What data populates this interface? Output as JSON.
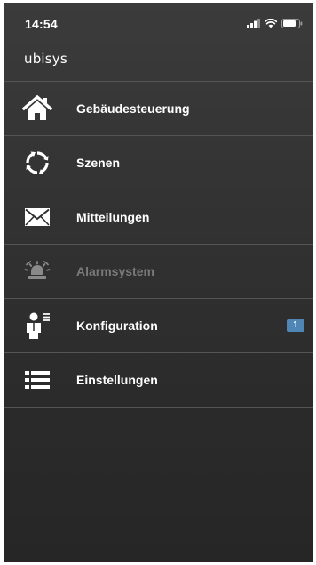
{
  "status_bar": {
    "time": "14:54",
    "icons": [
      "signal-icon",
      "wifi-icon",
      "battery-icon"
    ]
  },
  "header": {
    "logo": "ubisys"
  },
  "menu": {
    "items": [
      {
        "label": "Gebäudesteuerung",
        "icon": "house-icon",
        "enabled": true
      },
      {
        "label": "Szenen",
        "icon": "scenes-cycle-icon",
        "enabled": true
      },
      {
        "label": "Mitteilungen",
        "icon": "envelope-icon",
        "enabled": true
      },
      {
        "label": "Alarmsystem",
        "icon": "alarm-siren-icon",
        "enabled": false
      },
      {
        "label": "Konfiguration",
        "icon": "user-config-icon",
        "enabled": true,
        "badge": "1"
      },
      {
        "label": "Einstellungen",
        "icon": "list-settings-icon",
        "enabled": true
      }
    ]
  },
  "colors": {
    "background": "#333333",
    "separator": "#555555",
    "text": "#ffffff",
    "disabled_text": "#7a7a7a",
    "badge": "#4f86b5"
  }
}
